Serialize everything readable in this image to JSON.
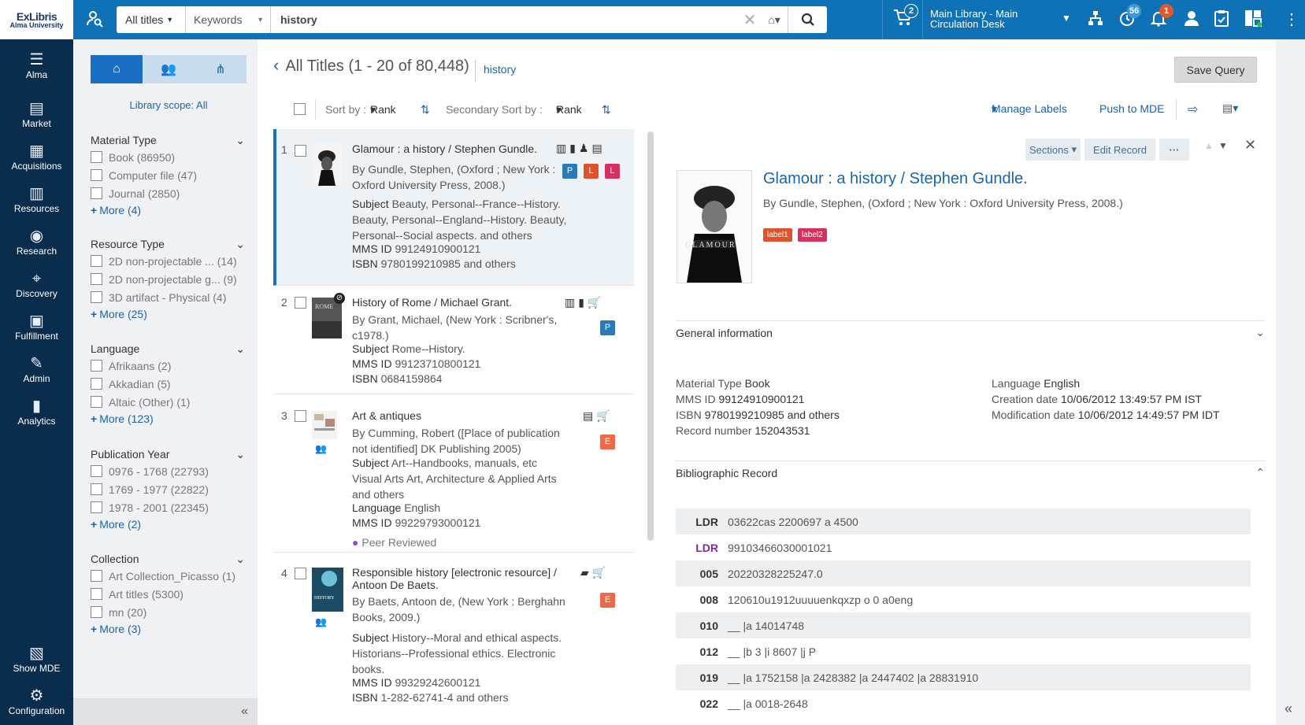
{
  "brand": {
    "line1": "ExLibris",
    "line2": "Alma University"
  },
  "search": {
    "scope": "All titles",
    "field": "Keywords",
    "query": "history"
  },
  "topbar": {
    "cart_count": "2",
    "desk": "Main Library - Main Circulation Desk",
    "badge_tasks": "56",
    "badge_alerts": "1"
  },
  "nav": [
    {
      "label": "Alma",
      "icon": "menu-star"
    },
    {
      "label": "Market",
      "icon": "store"
    },
    {
      "label": "Acquisitions",
      "icon": "ledger"
    },
    {
      "label": "Resources",
      "icon": "books"
    },
    {
      "label": "Research",
      "icon": "owl"
    },
    {
      "label": "Discovery",
      "icon": "telescope"
    },
    {
      "label": "Fulfillment",
      "icon": "box"
    },
    {
      "label": "Admin",
      "icon": "wrench"
    },
    {
      "label": "Analytics",
      "icon": "chart"
    },
    {
      "label": "Show MDE",
      "icon": "mde"
    },
    {
      "label": "Configuration",
      "icon": "gear"
    }
  ],
  "facets": {
    "scope_label": "Library scope:",
    "scope_value": "All",
    "groups": [
      {
        "title": "Material Type",
        "options": [
          "Book (86950)",
          "Computer file (47)",
          "Journal (2850)"
        ],
        "more": "More (4)"
      },
      {
        "title": "Resource Type",
        "options": [
          "2D non-projectable ... (14)",
          "2D non-projectable g... (9)",
          "3D artifact - Physical (4)"
        ],
        "more": "More (25)"
      },
      {
        "title": "Language",
        "options": [
          "Afrikaans (2)",
          "Akkadian (5)",
          "Altaic (Other) (1)"
        ],
        "more": "More (123)"
      },
      {
        "title": "Publication Year",
        "options": [
          "0976 - 1768 (22793)",
          "1769 - 1977 (22822)",
          "1978 - 2001 (22345)"
        ],
        "more": "More (2)"
      },
      {
        "title": "Collection",
        "options": [
          "Art Collection_Picasso (1)",
          "Art titles (5300)",
          "mn (20)"
        ],
        "more": "More (3)"
      }
    ]
  },
  "results": {
    "title": "All Titles (1 - 20 of 80,448)",
    "query": "history",
    "save": "Save Query",
    "sort_label": "Sort by :",
    "sort_value": "Rank",
    "sec_sort_label": "Secondary Sort by :",
    "sec_sort_value": "Rank",
    "manage_labels": "Manage Labels",
    "push_mde": "Push to MDE",
    "records": [
      {
        "num": "1",
        "title": "Glamour : a history / Stephen Gundle.",
        "by": "By Gundle, Stephen, (Oxford ; New York : Oxford University Press, 2008.)",
        "subject": "Beauty, Personal--France--History. Beauty, Personal--England--History. Beauty, Personal--Social aspects. and others",
        "mms": "99124910900121",
        "isbn": "9780199210985 and others"
      },
      {
        "num": "2",
        "title": "History of Rome / Michael Grant.",
        "by": "By Grant, Michael, (New York : Scribner's, c1978.)",
        "subject": "Rome--History.",
        "mms": "99123710800121",
        "isbn": "0684159864"
      },
      {
        "num": "3",
        "title": "Art & antiques",
        "by": "By Cumming, Robert ([Place of publication not identified] DK Publishing 2005)",
        "subject": "Art--Handbooks, manuals, etc Visual Arts Art, Architecture & Applied Arts and others",
        "language": "English",
        "mms": "99229793000121",
        "peer": "Peer Reviewed"
      },
      {
        "num": "4",
        "title": "Responsible history [electronic resource] / Antoon De Baets.",
        "by": "By Baets, Antoon de, (New York : Berghahn Books, 2009.)",
        "subject": "History--Moral and ethical aspects. Historians--Professional ethics. Electronic books.",
        "mms": "99329242600121",
        "isbn": "1-282-62741-4 and others"
      }
    ]
  },
  "labels": {
    "subject": "Subject",
    "mms": "MMS ID",
    "isbn": "ISBN",
    "language": "Language"
  },
  "detail": {
    "sections": "Sections",
    "edit": "Edit Record",
    "title": "Glamour : a history / Stephen Gundle.",
    "by": "By Gundle, Stephen, (Oxford ; New York : Oxford University Press, 2008.)",
    "label1": "label1",
    "label2": "label2",
    "gen_title": "General information",
    "gen": {
      "mat_label": "Material Type",
      "mat": "Book",
      "mms_label": "MMS ID",
      "mms": "99124910900121",
      "isbn_label": "ISBN",
      "isbn": "9780199210985 and others",
      "rec_label": "Record number",
      "rec": "152043531",
      "lang_label": "Language",
      "lang": "English",
      "cre_label": "Creation date",
      "cre": "10/06/2012 13:49:57 PM IST",
      "mod_label": "Modification date",
      "mod": "10/06/2012 14:49:57 PM IDT"
    },
    "bib_title": "Bibliographic Record",
    "marc": [
      [
        "LDR",
        "03622cas 2200697 a 4500"
      ],
      [
        "LDR",
        "99103466030001021"
      ],
      [
        "005",
        "20220328225247.0"
      ],
      [
        "008",
        "120610u1912uuuuenkqxzp o 0 a0eng"
      ],
      [
        "010",
        "__ |a 14014748"
      ],
      [
        "012",
        "__ |b 3 |i 8607 |j P"
      ],
      [
        "019",
        "__ |a 1752158 |a 2428382 |a 2447402 |a 28831910"
      ],
      [
        "022",
        "__ |a 0018-2648"
      ]
    ]
  },
  "colors": {
    "topbar": "#0f72b7",
    "leftnav": "#0a2c4d",
    "accent": "#1a6fc2",
    "tagP": "#2a7ab8",
    "tagL": "#e0522b",
    "tagL2": "#d6305f",
    "tagE": "#ec6a4a"
  }
}
